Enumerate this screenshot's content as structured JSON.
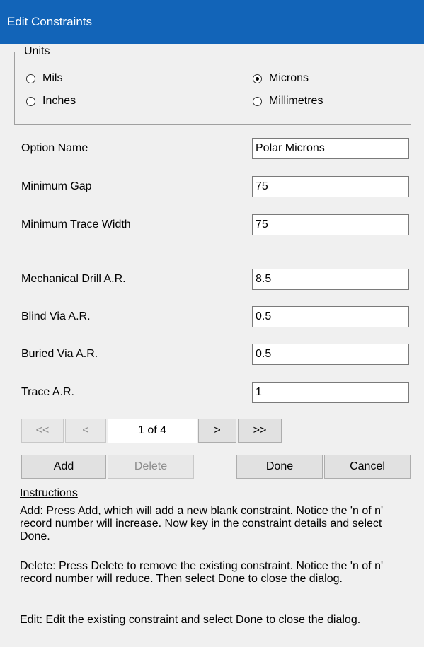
{
  "window": {
    "title": "Edit Constraints"
  },
  "units": {
    "legend": "Units",
    "options": [
      {
        "label": "Mils",
        "selected": false
      },
      {
        "label": "Microns",
        "selected": true
      },
      {
        "label": "Inches",
        "selected": false
      },
      {
        "label": "Millimetres",
        "selected": false
      }
    ]
  },
  "fields": {
    "option_name": {
      "label": "Option Name",
      "value": "Polar Microns"
    },
    "minimum_gap": {
      "label": "Minimum Gap",
      "value": "75"
    },
    "minimum_trace_width": {
      "label": "Minimum Trace Width",
      "value": "75"
    },
    "mechanical_drill_ar": {
      "label": "Mechanical Drill A.R.",
      "value": "8.5"
    },
    "blind_via_ar": {
      "label": "Blind Via A.R.",
      "value": "0.5"
    },
    "buried_via_ar": {
      "label": "Buried Via A.R.",
      "value": "0.5"
    },
    "trace_ar": {
      "label": "Trace A.R.",
      "value": "1"
    }
  },
  "navigator": {
    "first": "<<",
    "prev": "<",
    "record": "1 of 4",
    "next": ">",
    "last": ">>"
  },
  "buttons": {
    "add": "Add",
    "delete": "Delete",
    "done": "Done",
    "cancel": "Cancel"
  },
  "instructions": {
    "heading": "Instructions",
    "add": "Add: Press Add, which will add a new blank constraint. Notice the 'n of n' record number will increase. Now key in the constraint details and select Done.",
    "delete": "Delete: Press Delete to remove the existing constraint.  Notice the 'n of n' record number will reduce.  Then select Done to close the dialog.",
    "edit": "Edit: Edit the existing constraint and select Done to close the dialog."
  }
}
